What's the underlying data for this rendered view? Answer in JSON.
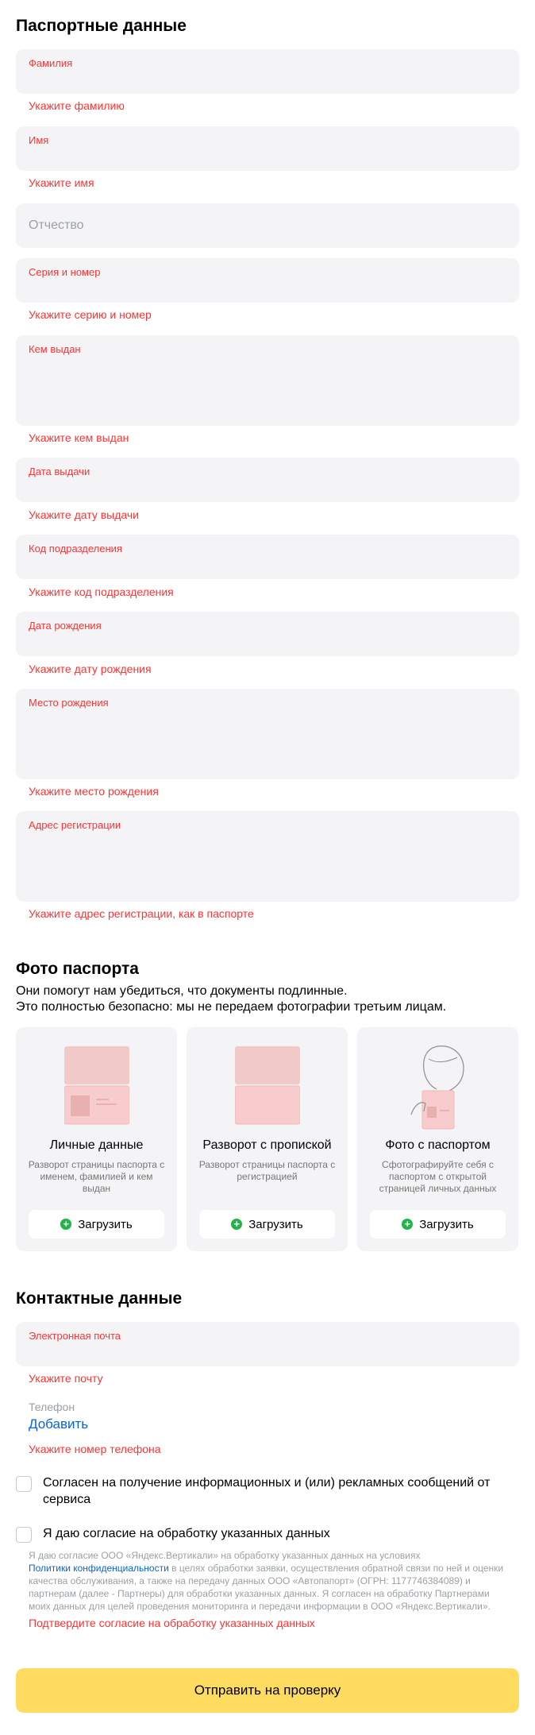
{
  "passport": {
    "title": "Паспортные данные",
    "fields": [
      {
        "label": "Фамилия",
        "error": "Укажите фамилию"
      },
      {
        "label": "Имя",
        "error": "Укажите имя"
      },
      {
        "placeholder": "Отчество"
      },
      {
        "label": "Серия и номер",
        "error": "Укажите серию и номер"
      },
      {
        "label": "Кем выдан",
        "error": "Укажите кем выдан"
      },
      {
        "label": "Дата выдачи",
        "error": "Укажите дату выдачи"
      },
      {
        "label": "Код подразделения",
        "error": "Укажите код подразделения"
      },
      {
        "label": "Дата рождения",
        "error": "Укажите дату рождения"
      },
      {
        "label": "Место рождения",
        "error": "Укажите место рождения"
      },
      {
        "label": "Адрес регистрации",
        "error": "Укажите адрес регистрации, как в паспорте"
      }
    ]
  },
  "photos": {
    "title": "Фото паспорта",
    "subtitle_line1": "Они помогут нам убедиться, что документы подлинные.",
    "subtitle_line2": "Это полностью безопасно: мы не передаем фотографии третьим лицам.",
    "cards": [
      {
        "title": "Личные данные",
        "desc": "Разворот страницы паспорта с именем, фамилией и кем выдан",
        "upload": "Загрузить",
        "icon": "passport-personal-page-icon"
      },
      {
        "title": "Разворот с пропиской",
        "desc": "Разворот страницы паспорта с регистрацией",
        "upload": "Загрузить",
        "icon": "passport-registration-page-icon"
      },
      {
        "title": "Фото с паспортом",
        "desc": "Сфотографируйте себя с паспортом с открытой страницей личных данных",
        "upload": "Загрузить",
        "icon": "selfie-with-passport-icon"
      }
    ],
    "upload_icon": "plus-circle-icon"
  },
  "contacts": {
    "title": "Контактные данные",
    "email_label": "Электронная почта",
    "email_error": "Укажите почту",
    "phone_label": "Телефон",
    "phone_add": "Добавить",
    "phone_error": "Укажите номер телефона"
  },
  "consents": {
    "marketing": "Согласен на получение информационных и (или) рекламных сообщений от сервиса",
    "processing": "Я даю согласие на обработку указанных данных",
    "body_part1": "Я даю согласие ООО «Яндекс.Вертикали» на обработку указанных данных на условиях",
    "body_link": "Политики конфиденциальности",
    "body_part2": " в целях обработки заявки, осуществления обратной связи по ней и оценки качества обслуживания, а также на передачу данных ООО «Автопапорт» (ОГРН: 1177746384089) и партнерам (далее - Партнеры) для обработки указанных данных. Я согласен на обработку Партнерами моих данных для целей проведения мониторинга и передачи информации в ООО «Яндекс.Вертикали».",
    "error": "Подтвердите согласие на обработку указанных данных"
  },
  "submit_label": "Отправить на проверку",
  "colors": {
    "error": "#ff3333",
    "field_bg": "#f4f4f6",
    "link": "#0a64d8",
    "submit_bg": "#ffdc60",
    "upload_plus": "#22b34a"
  }
}
